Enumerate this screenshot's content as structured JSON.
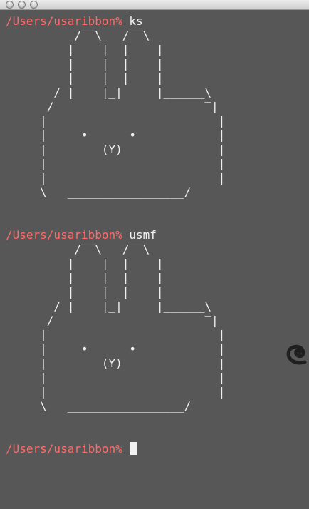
{
  "window": {
    "traffic_lights": [
      "close",
      "minimize",
      "zoom"
    ]
  },
  "terminal": {
    "lines": [
      {
        "type": "prompt",
        "prompt": "/Users/usaribbon%",
        "command": " ks"
      },
      {
        "type": "art",
        "text": "          /‾‾\\   /‾‾\\"
      },
      {
        "type": "art",
        "text": "         |    |  |    |"
      },
      {
        "type": "art",
        "text": "         |    |  |    |"
      },
      {
        "type": "art",
        "text": "         |    |  |    |"
      },
      {
        "type": "art",
        "text": "       / |    |_|     |______\\"
      },
      {
        "type": "art",
        "text": "      /                      ‾|"
      },
      {
        "type": "art",
        "text": "     |                         |"
      },
      {
        "type": "art",
        "text": "     |     •      •            |"
      },
      {
        "type": "art",
        "text": "     |        (Y)              |"
      },
      {
        "type": "art",
        "text": "     |                         |"
      },
      {
        "type": "art",
        "text": "     |                         |"
      },
      {
        "type": "art",
        "text": "     \\   _________________/"
      },
      {
        "type": "blank",
        "text": ""
      },
      {
        "type": "art",
        "text": " "
      },
      {
        "type": "prompt",
        "prompt": "/Users/usaribbon%",
        "command": " usmf"
      },
      {
        "type": "art",
        "text": "          /‾‾\\   /‾‾\\"
      },
      {
        "type": "art",
        "text": "         |    |  |    |"
      },
      {
        "type": "art",
        "text": "         |    |  |    |"
      },
      {
        "type": "art",
        "text": "         |    |  |    |"
      },
      {
        "type": "art",
        "text": "       / |    |_|     |______\\"
      },
      {
        "type": "art",
        "text": "      /                      ‾|"
      },
      {
        "type": "art",
        "text": "     |                         |"
      },
      {
        "type": "art",
        "text": "     |     •      •            |"
      },
      {
        "type": "art",
        "text": "     |        (Y)              |"
      },
      {
        "type": "art",
        "text": "     |                         |"
      },
      {
        "type": "art",
        "text": "     |                         |"
      },
      {
        "type": "art",
        "text": "     \\   _________________/"
      },
      {
        "type": "blank",
        "text": ""
      },
      {
        "type": "art",
        "text": " "
      },
      {
        "type": "prompt",
        "prompt": "/Users/usaribbon%",
        "command": " ",
        "cursor": true
      }
    ]
  },
  "colors": {
    "background": "#575757",
    "prompt": "#ff6a6a",
    "text": "#f2f2f2"
  }
}
